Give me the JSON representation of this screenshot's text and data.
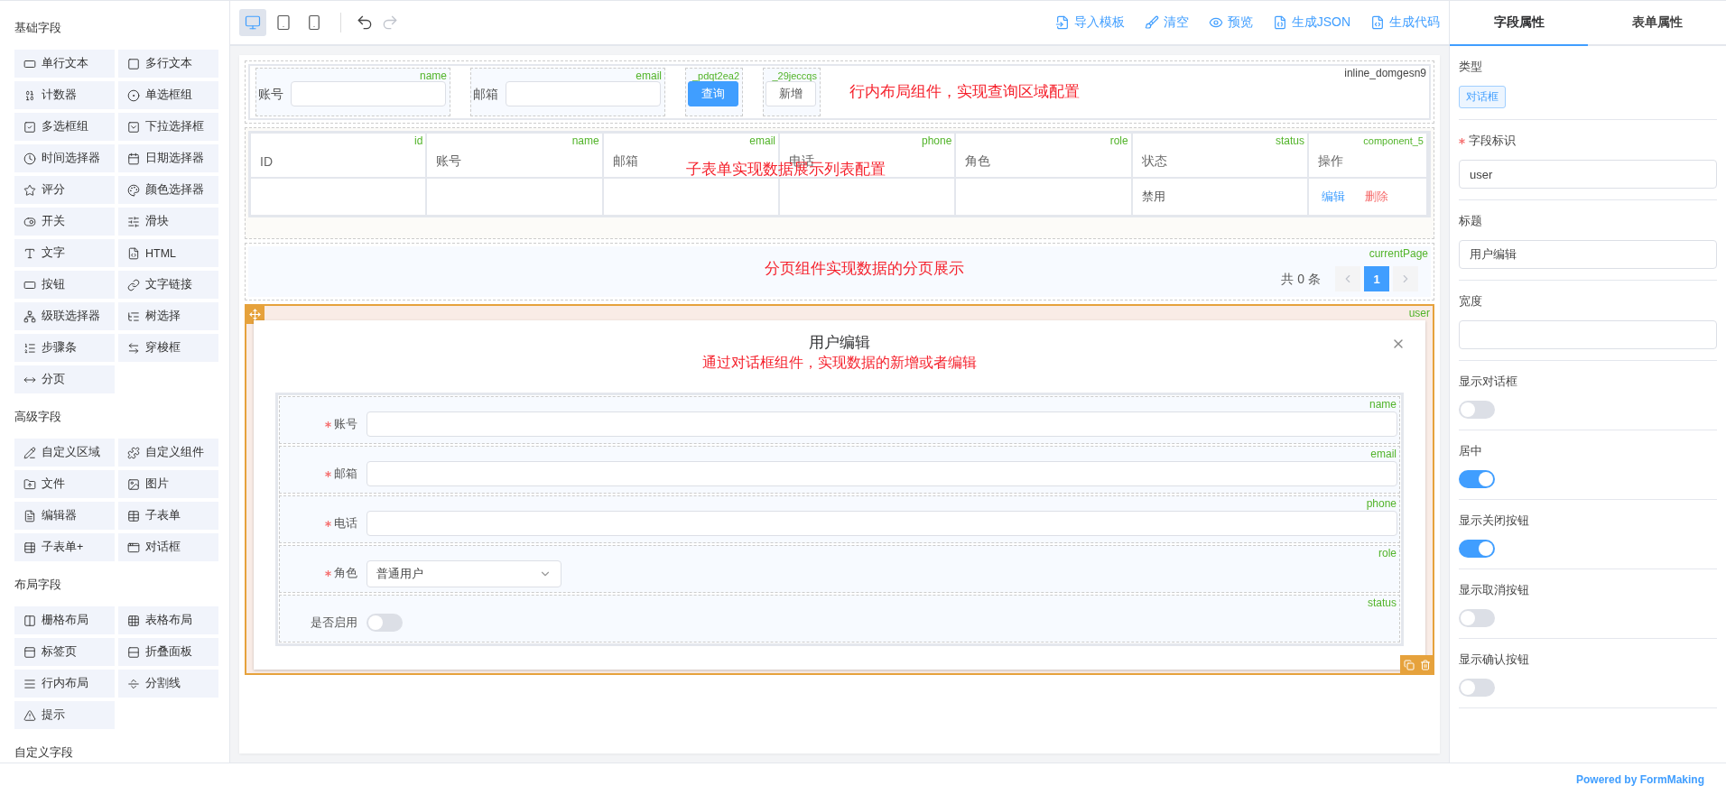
{
  "sidebar": {
    "groups": [
      {
        "title": "基础字段",
        "items": [
          {
            "label": "单行文本"
          },
          {
            "label": "多行文本"
          },
          {
            "label": "计数器"
          },
          {
            "label": "单选框组"
          },
          {
            "label": "多选框组"
          },
          {
            "label": "下拉选择框"
          },
          {
            "label": "时间选择器"
          },
          {
            "label": "日期选择器"
          },
          {
            "label": "评分"
          },
          {
            "label": "颜色选择器"
          },
          {
            "label": "开关"
          },
          {
            "label": "滑块"
          },
          {
            "label": "文字"
          },
          {
            "label": "HTML"
          },
          {
            "label": "按钮"
          },
          {
            "label": "文字链接"
          },
          {
            "label": "级联选择器"
          },
          {
            "label": "树选择"
          },
          {
            "label": "步骤条"
          },
          {
            "label": "穿梭框"
          },
          {
            "label": "分页"
          }
        ]
      },
      {
        "title": "高级字段",
        "items": [
          {
            "label": "自定义区域"
          },
          {
            "label": "自定义组件"
          },
          {
            "label": "文件"
          },
          {
            "label": "图片"
          },
          {
            "label": "编辑器"
          },
          {
            "label": "子表单"
          },
          {
            "label": "子表单+"
          },
          {
            "label": "对话框"
          }
        ]
      },
      {
        "title": "布局字段",
        "items": [
          {
            "label": "栅格布局"
          },
          {
            "label": "表格布局"
          },
          {
            "label": "标签页"
          },
          {
            "label": "折叠面板"
          },
          {
            "label": "行内布局"
          },
          {
            "label": "分割线"
          },
          {
            "label": "提示"
          }
        ]
      },
      {
        "title": "自定义字段"
      }
    ]
  },
  "toolbar": {
    "devices": [
      {
        "selected": true
      },
      {
        "selected": false
      },
      {
        "selected": false
      }
    ],
    "history": [
      {
        "disabled": false
      },
      {
        "disabled": true
      }
    ],
    "actions": [
      {
        "label": "导入模板"
      },
      {
        "label": "清空"
      },
      {
        "label": "预览"
      },
      {
        "label": "生成JSON"
      },
      {
        "label": "生成代码"
      }
    ]
  },
  "canvas": {
    "inline_query": {
      "id": "inline_domgesn9",
      "note": "行内布局组件，实现查询区域配置",
      "fields": [
        {
          "kind": "input",
          "label": "账号",
          "key": "name"
        },
        {
          "kind": "input",
          "label": "邮箱",
          "key": "email"
        },
        {
          "kind": "button",
          "label": "查询",
          "key": "_pdqt2ea2",
          "primary": true
        },
        {
          "kind": "button",
          "label": "新增",
          "key": "_29jeccqs",
          "primary": false
        }
      ]
    },
    "subform": {
      "note": "子表单实现数据展示列表配置",
      "columns": [
        {
          "title": "ID",
          "key": "id"
        },
        {
          "title": "账号",
          "key": "name"
        },
        {
          "title": "邮箱",
          "key": "email"
        },
        {
          "title": "电话",
          "key": "phone"
        },
        {
          "title": "角色",
          "key": "role"
        },
        {
          "title": "状态",
          "key": "status"
        },
        {
          "title": "操作",
          "key": "component_5"
        }
      ],
      "rows": [
        {
          "status": "禁用",
          "actions": [
            {
              "label": "编辑",
              "kind": "edit"
            },
            {
              "label": "删除",
              "kind": "delete"
            }
          ]
        }
      ]
    },
    "pagination": {
      "note": "分页组件实现数据的分页展示",
      "key": "currentPage",
      "total": "共 0 条",
      "pages": [
        {
          "label": "1",
          "selected": true
        }
      ]
    },
    "dialog": {
      "key": "user",
      "selected": true,
      "title": "用户编辑",
      "note": "通过对话框组件，实现数据的新增或者编辑",
      "fields": [
        {
          "kind": "input",
          "label": "账号",
          "key": "name",
          "required": true
        },
        {
          "kind": "input",
          "label": "邮箱",
          "key": "email",
          "required": true
        },
        {
          "kind": "input",
          "label": "电话",
          "key": "phone",
          "required": true
        },
        {
          "kind": "select",
          "label": "角色",
          "key": "role",
          "required": true,
          "value": "普通用户"
        },
        {
          "kind": "switch",
          "label": "是否启用",
          "key": "status",
          "required": false,
          "on": false
        }
      ]
    }
  },
  "right_panel": {
    "tabs": [
      {
        "label": "字段属性",
        "selected": true
      },
      {
        "label": "表单属性",
        "selected": false
      }
    ],
    "properties": [
      {
        "kind": "tag",
        "label": "类型",
        "value": "对话框"
      },
      {
        "kind": "input",
        "label": "字段标识",
        "required": true,
        "value": "user"
      },
      {
        "kind": "input",
        "label": "标题",
        "required": false,
        "value": "用户编辑"
      },
      {
        "kind": "input",
        "label": "宽度",
        "required": false
      },
      {
        "kind": "switch",
        "label": "显示对话框",
        "on": false
      },
      {
        "kind": "switch",
        "label": "居中",
        "on": true
      },
      {
        "kind": "switch",
        "label": "显示关闭按钮",
        "on": true
      },
      {
        "kind": "switch",
        "label": "显示取消按钮",
        "on": false
      },
      {
        "kind": "switch",
        "label": "显示确认按钮",
        "on": false
      }
    ]
  },
  "footer": {
    "powered_by": "Powered by FormMaking"
  }
}
